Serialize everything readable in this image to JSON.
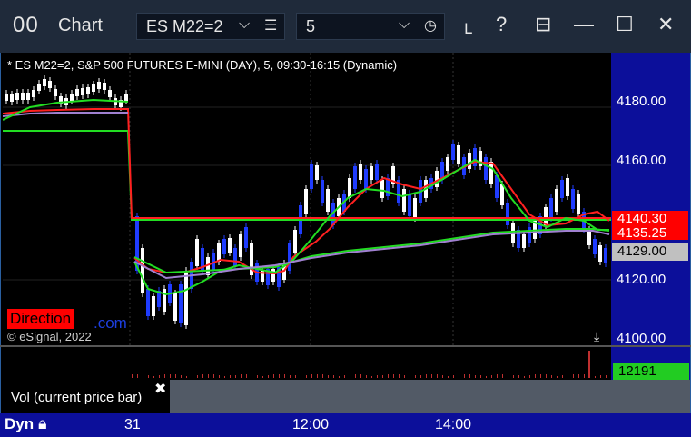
{
  "title_bar": {
    "app_icon_text": "00",
    "title": "Chart",
    "symbol_combo": "ES M22=2",
    "interval_combo": "5"
  },
  "chart": {
    "description": "* ES M22=2, S&P 500 FUTURES E-MINI (DAY), 5, 09:30-16:15 (Dynamic)",
    "y_labels": [
      "4180.00",
      "4160.00",
      "4120.00",
      "4100.00"
    ],
    "price_tags": {
      "red": "4140.30",
      "red2": "4135.25",
      "last": "4129.00"
    },
    "badge_direction": "Direction",
    "badge_dotcom": ".com",
    "copyright": "© eSignal, 2022",
    "jump_icon": "⤓"
  },
  "volume": {
    "label": "Vol (current price bar)",
    "close_glyph": "✖",
    "value_tag": "12191"
  },
  "x_axis": {
    "mode": "Dyn",
    "labels": [
      "31",
      "12:00",
      "14:00"
    ]
  },
  "colors": {
    "accent_red": "#ff0000",
    "green_line": "#22dd22",
    "purple_line": "#a080d0",
    "candle_up": "#ffffff",
    "candle_down": "#1f3cff"
  }
}
